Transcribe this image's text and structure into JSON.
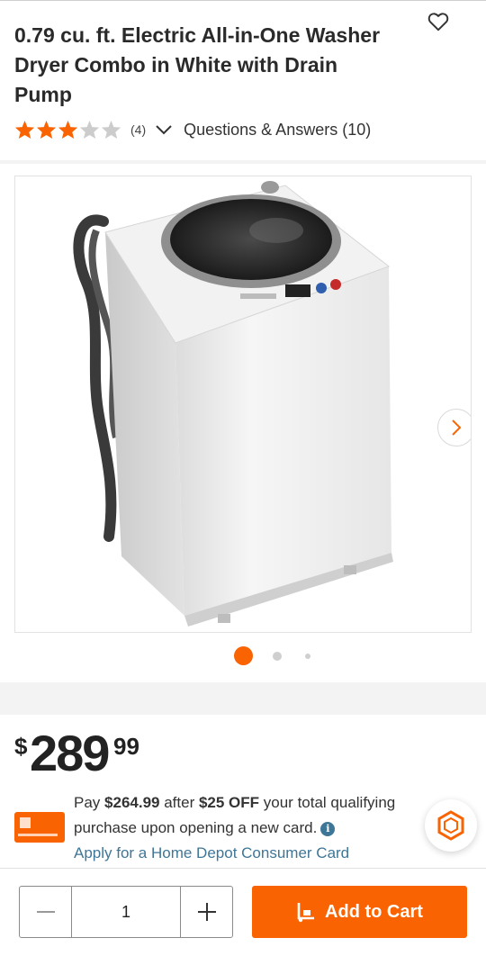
{
  "product": {
    "title": "0.79 cu. ft. Electric All-in-One Washer Dryer Combo in White with Drain Pump",
    "rating": 3,
    "rating_max": 5,
    "review_count": "(4)",
    "qa_label": "Questions & Answers (10)"
  },
  "gallery": {
    "image_name": "washer-dryer-combo",
    "image_count": 3,
    "active_index": 0
  },
  "pricing": {
    "dollar_sign": "$",
    "whole": "289",
    "cents": "99"
  },
  "promo": {
    "pay_prefix": "Pay ",
    "pay_amount": "$264.99",
    "after_text": " after ",
    "off_amount": "$25 OFF",
    "rest_text": " your total qualifying purchase upon opening a new card.",
    "apply_link": "Apply for a Home Depot Consumer Card"
  },
  "cart": {
    "quantity": "1",
    "add_label": "Add to Cart"
  },
  "colors": {
    "brand_orange": "#f96302",
    "link_blue": "#3e7697",
    "star_empty": "#cccccc"
  },
  "icons": {
    "favorite": "heart-icon",
    "expand": "chevron-down-icon",
    "next": "chevron-right-icon",
    "info": "info-icon",
    "chat": "hexagon-icon",
    "cart": "dolly-icon"
  }
}
